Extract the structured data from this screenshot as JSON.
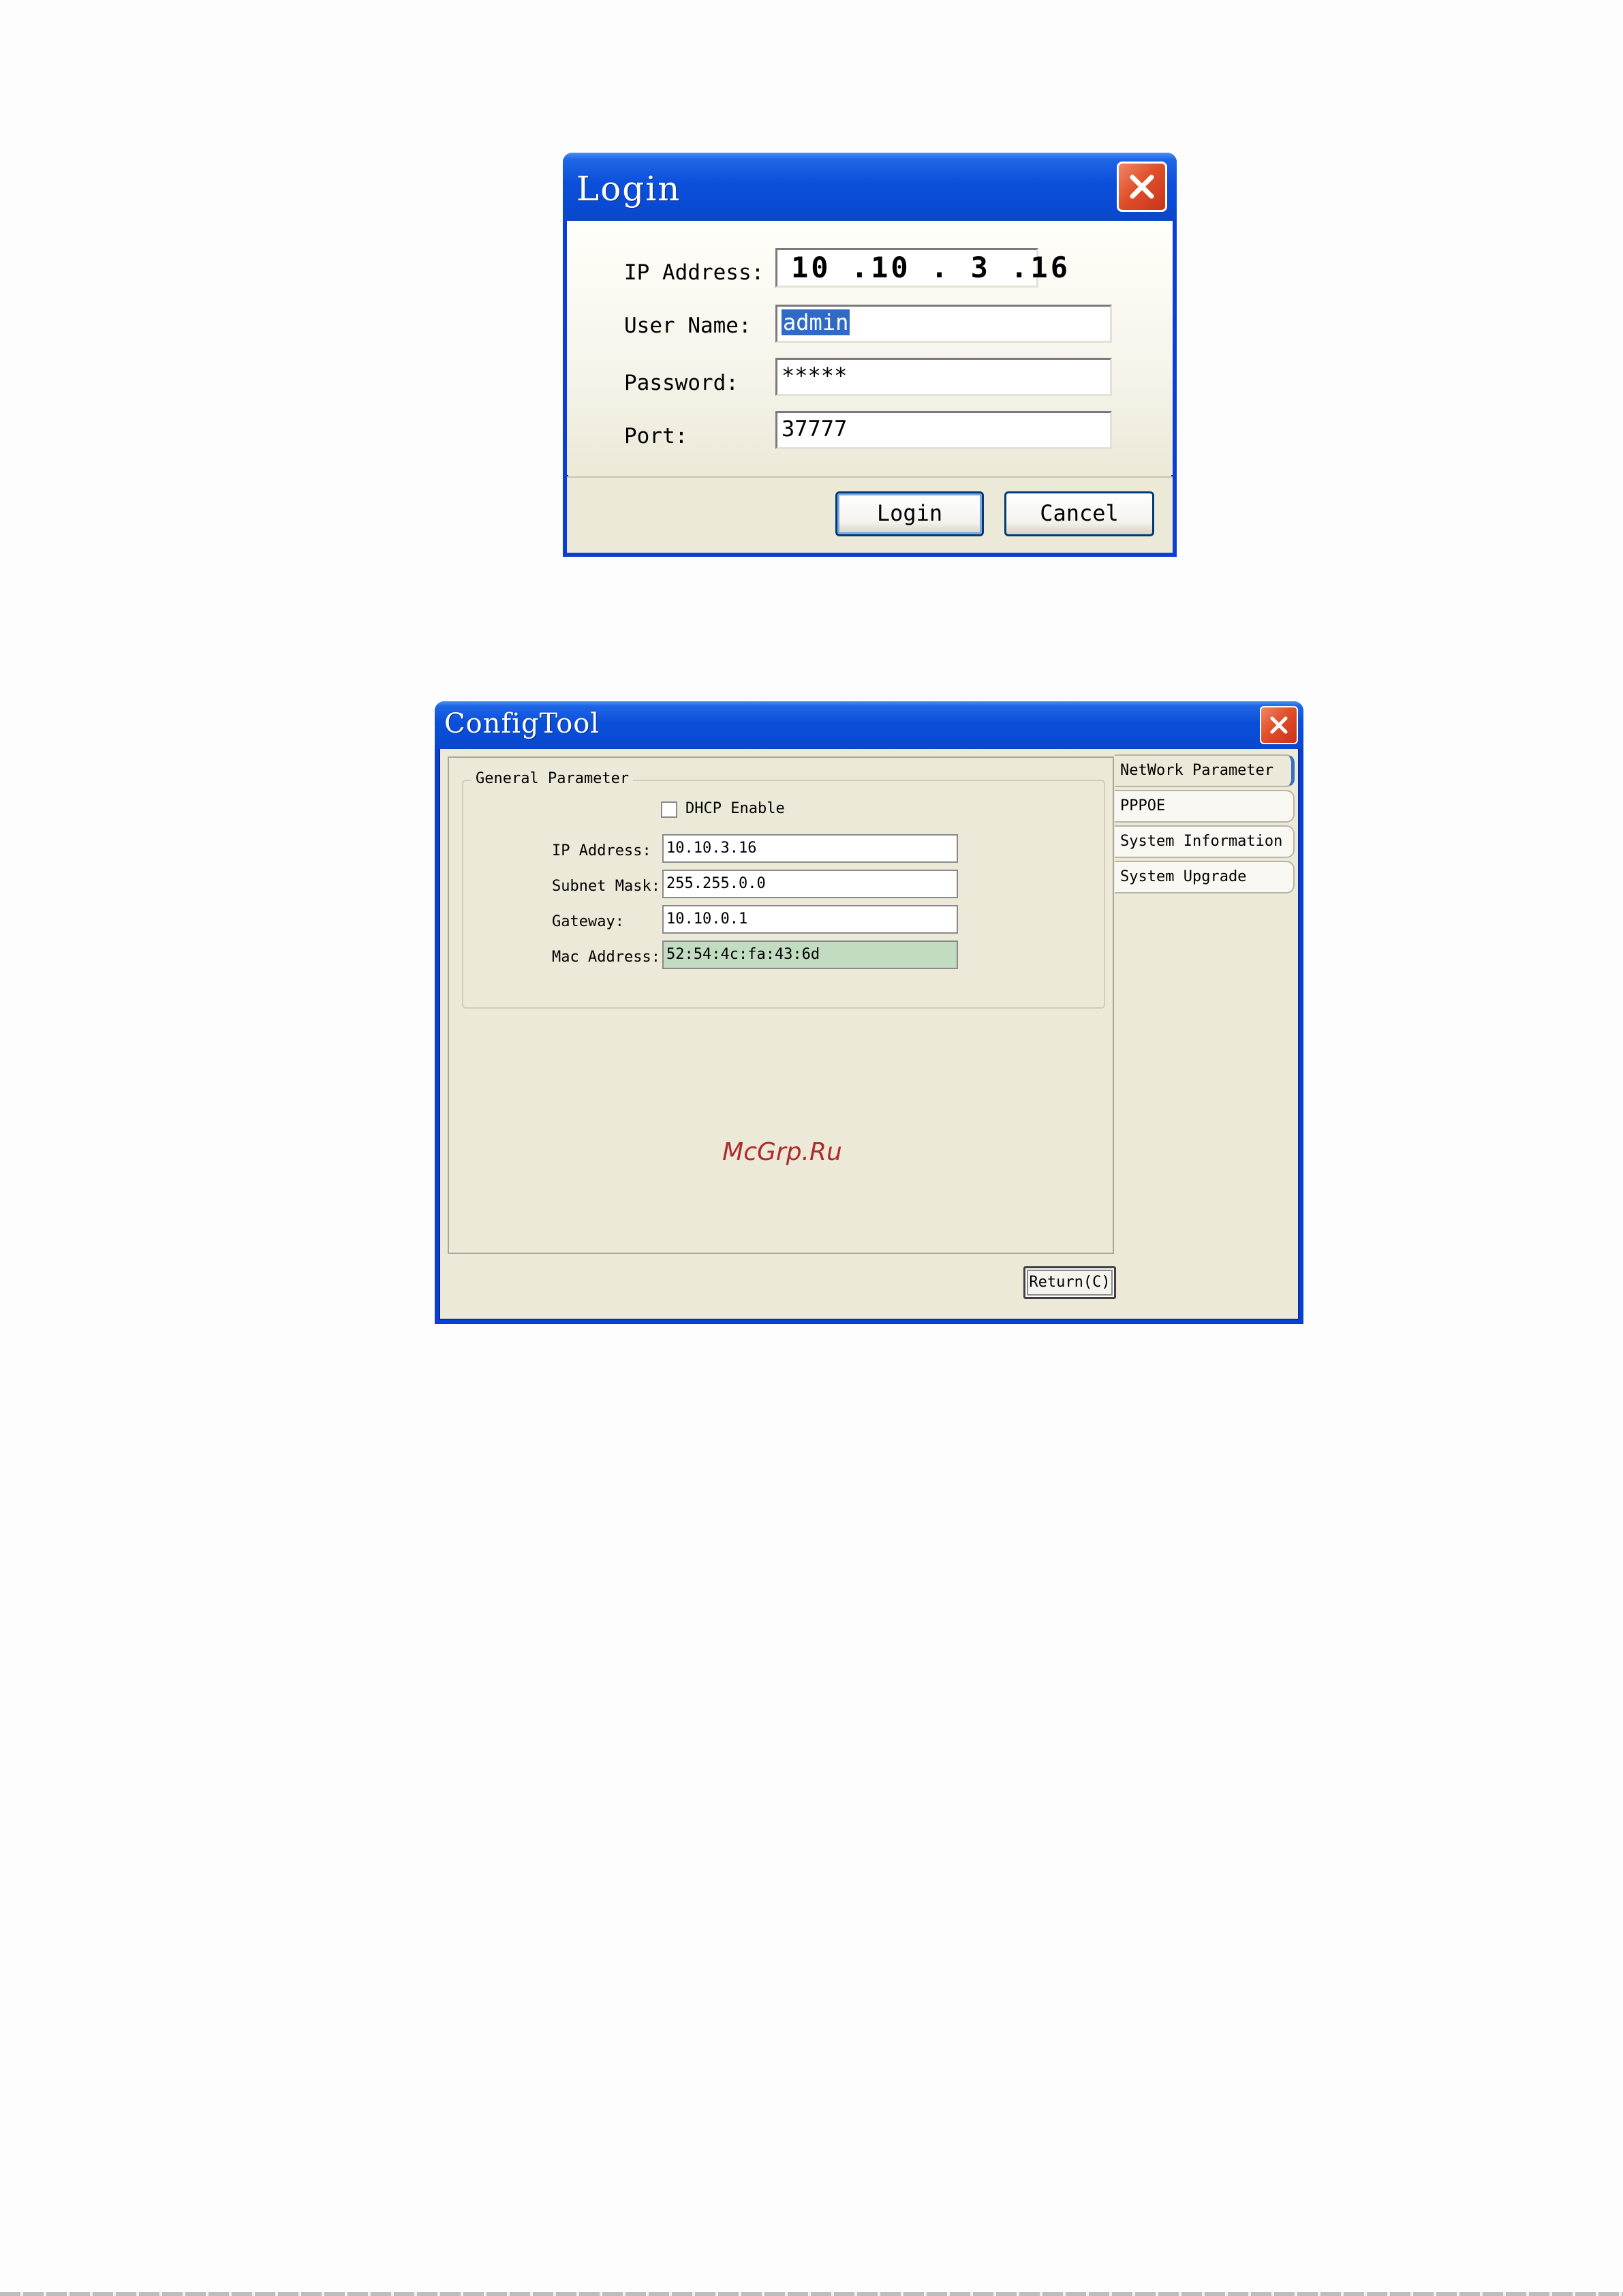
{
  "login_dialog": {
    "title": "Login",
    "close_icon": "close-icon",
    "ip_label": "IP Address:",
    "ip_value": "10 .10 . 3 .16",
    "username_label": "User Name:",
    "username_value": "admin",
    "password_label": "Password:",
    "password_value": "*****",
    "port_label": "Port:",
    "port_value": "37777",
    "login_button": "Login",
    "cancel_button": "Cancel"
  },
  "config_tool": {
    "title": "ConfigTool",
    "close_icon": "close-icon",
    "group_title": "General Parameter",
    "dhcp_label": "DHCP Enable",
    "dhcp_checked": false,
    "ip_label": "IP Address:",
    "ip_value": "10.10.3.16",
    "subnet_label": "Subnet Mask:",
    "subnet_value": "255.255.0.0",
    "gateway_label": "Gateway:",
    "gateway_value": "10.10.0.1",
    "mac_label": "Mac Address:",
    "mac_value": "52:54:4c:fa:43:6d",
    "tabs": [
      {
        "label": "NetWork Parameter",
        "active": true
      },
      {
        "label": "PPPOE",
        "active": false
      },
      {
        "label": "System Information",
        "active": false
      },
      {
        "label": "System Upgrade",
        "active": false
      }
    ],
    "return_button": "Return(C)",
    "watermark": "McGrp.Ru"
  },
  "colors": {
    "title_bar": "#0a4ad2",
    "close_button": "#e0502a",
    "window_bg": "#ece9d8",
    "selection": "#316ac5",
    "mac_field_bg": "#c1dcc0",
    "watermark": "#b02a2a"
  }
}
